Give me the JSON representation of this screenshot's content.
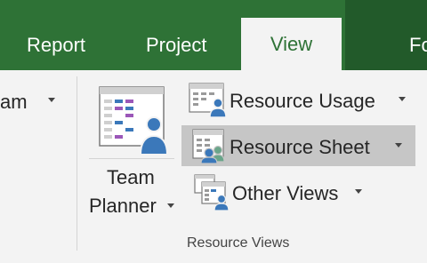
{
  "tabs": [
    {
      "label": "Report",
      "active": false
    },
    {
      "label": "Project",
      "active": false
    },
    {
      "label": "View",
      "active": true
    },
    {
      "label": "Fo",
      "active": false
    }
  ],
  "left_partial_label": "am",
  "team_planner": {
    "line1": "Team",
    "line2": "Planner"
  },
  "views": {
    "resource_usage": "Resource Usage",
    "resource_sheet": "Resource Sheet",
    "other_views": "Other Views"
  },
  "group_label": "Resource Views",
  "colors": {
    "tab_bar": "#2e7236",
    "tab_bar_dark": "#225a2a",
    "active_tab_text": "#2e7236",
    "ribbon_bg": "#f3f3f3",
    "selected_bg": "#c6c6c6",
    "person_blue": "#3b78ba",
    "gantt_purple": "#9b57b8"
  },
  "icons": {
    "team_planner": "team-planner-icon",
    "resource_usage": "resource-usage-icon",
    "resource_sheet": "resource-sheet-icon",
    "other_views": "other-views-icon"
  }
}
